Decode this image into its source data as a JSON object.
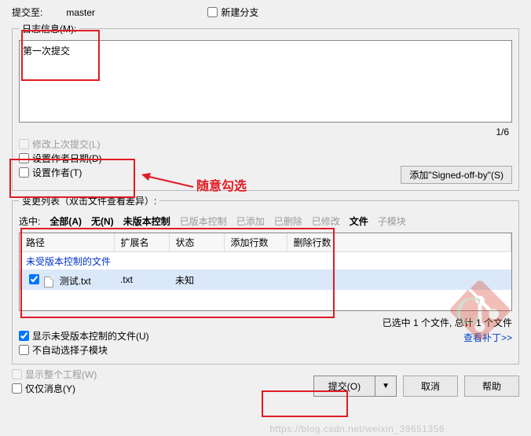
{
  "top": {
    "commit_to_label": "提交至:",
    "branch": "master",
    "new_branch": "新建分支"
  },
  "log": {
    "legend": "日志信息(M):",
    "text": "第一次提交",
    "counter": "1/6",
    "amend_last": "修改上次提交(L)",
    "set_author_date": "设置作者日期(D)",
    "set_author": "设置作者(T)",
    "signed_off_btn": "添加\"Signed-off-by\"(S)"
  },
  "changes": {
    "legend": "变更列表（双击文件查看差异）:",
    "select_label": "选中:",
    "filters": {
      "all": "全部(A)",
      "none": "无(N)",
      "unversioned": "未版本控制",
      "versioned": "已版本控制",
      "added": "已添加",
      "deleted": "已删除",
      "modified": "已修改",
      "files": "文件",
      "submodules": "子模块"
    },
    "columns": {
      "path": "路径",
      "ext": "扩展名",
      "status": "状态",
      "add_lines": "添加行数",
      "del_lines": "删除行数"
    },
    "group_label": "未受版本控制的文件",
    "rows": [
      {
        "checked": true,
        "name": "测试.txt",
        "ext": ".txt",
        "status": "未知",
        "add": "",
        "del": ""
      }
    ],
    "summary": "已选中 1 个文件, 总计 1 个文件",
    "show_unversioned": "显示未受版本控制的文件(U)",
    "no_auto_submodule": "不自动选择子模块",
    "view_patch": "查看补丁>>"
  },
  "bottom": {
    "show_whole_project": "显示整个工程(W)",
    "only_message": "仅仅消息(Y)",
    "commit": "提交(O)",
    "cancel": "取消",
    "help": "帮助"
  },
  "annotations": {
    "random_check": "随意勾选"
  },
  "watermark": "https://blog.csdn.net/weixin_39651356"
}
